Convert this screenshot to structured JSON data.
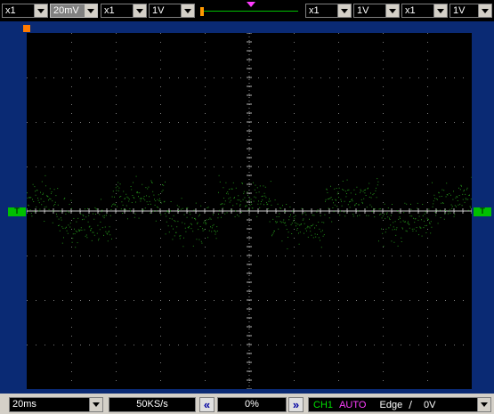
{
  "toolbar": {
    "ch1_probe": "x1",
    "ch1_volts": "20mV",
    "ch2_probe": "x1",
    "ch2_volts": "1V",
    "ch3_probe": "x1",
    "ch3_volts": "1V",
    "ch4_probe": "x1",
    "ch4_volts": "1V"
  },
  "markers": {
    "left_trigger": "T",
    "right_trigger": "T"
  },
  "status": {
    "timebase": "20ms",
    "sample_rate": "50KS/s",
    "position": "0%",
    "trigger_source": "CH1",
    "trigger_mode": "AUTO",
    "trigger_type": "Edge",
    "trigger_level": "0V",
    "edge_glyph": "∕"
  },
  "colors": {
    "trace": "#2aa81e",
    "trigger_mode": "#ff40ff",
    "trigger_source": "#00e000",
    "frame": "#0a2a74"
  },
  "trace": {
    "description_levels": [
      {
        "start": 0,
        "end": 14,
        "level": 0.5
      },
      {
        "start": 14,
        "end": 38,
        "level": -0.5
      },
      {
        "start": 38,
        "end": 62,
        "level": 0.5
      },
      {
        "start": 62,
        "end": 86,
        "level": -0.5
      },
      {
        "start": 86,
        "end": 110,
        "level": 0.5
      },
      {
        "start": 110,
        "end": 134,
        "level": -0.5
      },
      {
        "start": 134,
        "end": 158,
        "level": 0.5
      },
      {
        "start": 158,
        "end": 182,
        "level": -0.5
      },
      {
        "start": 182,
        "end": 200,
        "level": 0.5
      }
    ]
  }
}
